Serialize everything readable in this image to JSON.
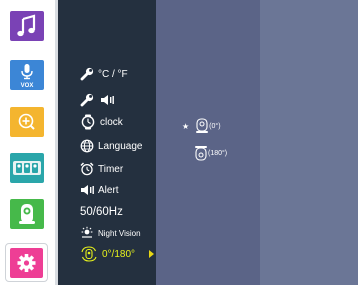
{
  "sidebar": {
    "items": [
      {
        "name": "music",
        "icon": "music-note-icon",
        "color": "#7a42b5"
      },
      {
        "name": "vox",
        "icon": "microphone-icon",
        "label": "VOX",
        "color": "#3c86d6"
      },
      {
        "name": "zoom",
        "icon": "zoom-in-icon",
        "color": "#f4b52f"
      },
      {
        "name": "camera",
        "icon": "camera-list-icon",
        "color": "#2aa6aa"
      },
      {
        "name": "night-light",
        "icon": "baby-monitor-icon",
        "color": "#46b94a"
      },
      {
        "name": "settings",
        "icon": "gear-icon",
        "color": "#ee3e95",
        "selected": true
      }
    ]
  },
  "menu": {
    "items": [
      {
        "id": "temperature-unit",
        "icon": "wrench-icon",
        "label": "°C / °F"
      },
      {
        "id": "alert-volume",
        "icon": "wrench-speaker-icon",
        "label": ""
      },
      {
        "id": "clock",
        "icon": "clock-icon",
        "label": "clock"
      },
      {
        "id": "language",
        "icon": "globe-icon",
        "label": "Language"
      },
      {
        "id": "timer",
        "icon": "alarm-clock-icon",
        "label": "Timer"
      },
      {
        "id": "alert",
        "icon": "speaker-icon",
        "label": "Alert"
      },
      {
        "id": "frequency",
        "icon": "",
        "label": "50/60Hz"
      },
      {
        "id": "night-vision",
        "icon": "night-vision-icon",
        "label": "Night Vision"
      },
      {
        "id": "rotation",
        "icon": "camera-rotate-icon",
        "label": "0°/180°",
        "selected": true,
        "color": "#e7f21c"
      }
    ]
  },
  "submenu": {
    "options": [
      {
        "label": "(0°)",
        "icon": "camera-upright-icon",
        "selected": true,
        "marker": "★"
      },
      {
        "label": "(180°)",
        "icon": "camera-flipped-icon",
        "selected": false
      }
    ]
  }
}
